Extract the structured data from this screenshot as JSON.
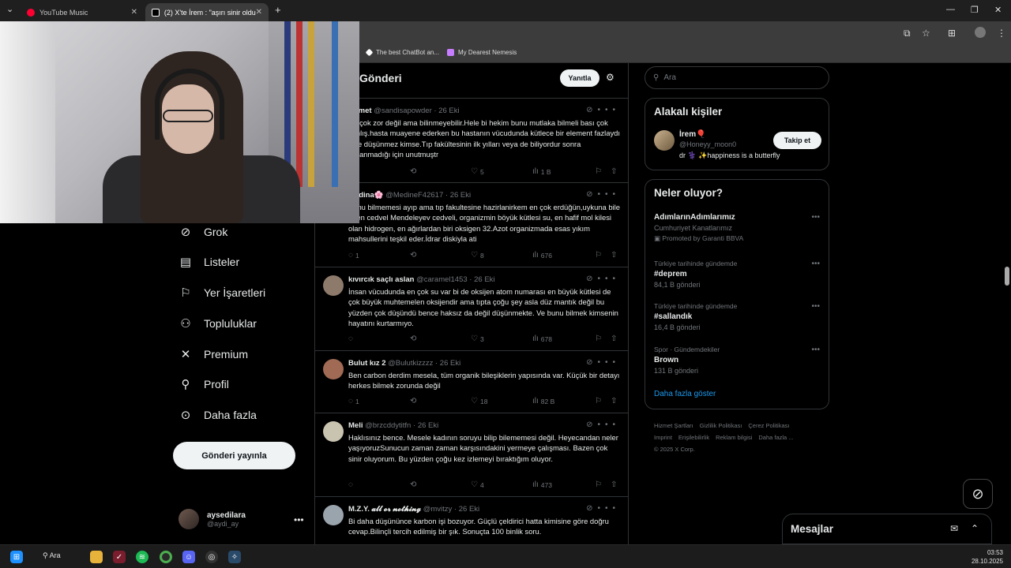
{
  "browser": {
    "tabs": [
      {
        "title": "YouTube Music",
        "active": false
      },
      {
        "title": "(2) X'te İrem  : \"aşırı sinir oldu...",
        "active": true
      }
    ],
    "new_tab": "+",
    "bookmarks": [
      "The best ChatBot an...",
      "My Dearest Nemesis"
    ]
  },
  "nav": {
    "items": [
      "Grok",
      "Listeler",
      "Yer İşaretleri",
      "Topluluklar",
      "Premium",
      "Profil",
      "Daha fazla"
    ],
    "post_button": "Gönderi yayınla",
    "user": {
      "name": "aysedilara",
      "handle": "@aydi_ay"
    }
  },
  "center": {
    "title": "Gönderi",
    "reply_button": "Yanıtla",
    "tweets": [
      {
        "name": "Ahmet",
        "handle": "@sandisapowder",
        "date": "26 Eki",
        "text": "Bu çok zor değil ama bilinmeyebilir.Hele bi hekim bunu mutlaka bilmeli bası çok yanlış.hasta muayene ederken bu hastanın vücudunda kütlece bir element fazlaydı diye düşünmez kimse.Tıp fakültesinin ilk yılları veya de biliyordur sonra kullanmadığı için unutmuştr",
        "replies": "",
        "retweets": "",
        "likes": "5",
        "views": "1 B"
      },
      {
        "name": "Medina🌸",
        "handle": "@MedineF42617",
        "date": "26 Eki",
        "text": "Bunu bilmemesi ayıp ama tıp fakultesine hazirlanirkem en çok erdüğün,uykuna bile giren cedvel Mendeleyev cedveli, organizmin böyük kütlesi su, en hafif mol kilesi olan hidrogen, en ağırlardan biri oksigen 32.Azot organizmada esas yıkım mahsullerini teşkil eder.İdrar diskiyla ati",
        "replies": "1",
        "retweets": "",
        "likes": "8",
        "views": "676"
      },
      {
        "name": "kıvırcık saçlı aslan",
        "handle": "@caramel1453",
        "date": "26 Eki",
        "text": "İnsan vücudunda en çok su var bi de oksijen atom numarası en büyük kütlesi de çok büyük muhtemelen oksijendir ama tıpta çoğu şey asla düz mantık değil bu yüzden çok düşündü bence haksız da değil düşünmekte. Ve bunu bilmek kimsenin hayatını kurtarmıyo.",
        "replies": "",
        "retweets": "",
        "likes": "3",
        "views": "678"
      },
      {
        "name": "Bulut kız 2",
        "handle": "@Bulutkizzzz",
        "date": "26 Eki",
        "text": "Ben carbon derdim mesela, tüm organik bileşiklerin yapısında var. Küçük bir detayı herkes bilmek zorunda değil",
        "replies": "1",
        "retweets": "",
        "likes": "18",
        "views": "82 B"
      },
      {
        "name": "Meli",
        "handle": "@brzcddytitfn",
        "date": "26 Eki",
        "text": "Haklısınız bence. Mesele kadının soruyu bilip bilememesi değil. Heyecandan neler yaşıyoruzSunucun zaman zaman karşısındakini yermeye çalışması. Bazen çok sinir oluyorum. Bu yüzden çoğu kez izlemeyi bıraktığım oluyor.",
        "replies": "",
        "retweets": "",
        "likes": "4",
        "views": "473"
      },
      {
        "name": "M.Z.Y. 𝓪𝓵𝓵 𝓸𝓻 𝓷𝓸𝓽𝓱𝓲𝓷𝓰",
        "handle": "@mvitzy",
        "date": "26 Eki",
        "text": "Bi daha düşününce karbon işi bozuyor. Güçlü çeldirici hatta kimisine göre doğru cevap.Bilinçli tercih edilmiş bir şık. Sonuçta 100 binlik soru.",
        "replies": "",
        "retweets": "",
        "likes": "",
        "views": ""
      }
    ]
  },
  "right": {
    "search_placeholder": "Ara",
    "related": {
      "title": "Alakalı kişiler",
      "person": {
        "name": "İrem🎈",
        "handle": "@Honeyy_moon0",
        "bio": "dr ⚕️ ✨happiness is a butterfly"
      },
      "follow_button": "Takip et"
    },
    "trends": {
      "title": "Neler oluyor?",
      "items": [
        {
          "category": "",
          "name": "AdımlarınAdımlarımız",
          "sub": "Cumhuriyet Kanatlarımız",
          "promoted": "Promoted by Garanti BBVA"
        },
        {
          "category": "Türkiye tarihinde gündemde",
          "name": "#deprem",
          "sub": "84,1 B gönderi"
        },
        {
          "category": "Türkiye tarihinde gündemde",
          "name": "#sallandık",
          "sub": "16,4 B gönderi"
        },
        {
          "category": "Spor · Gündemdekiler",
          "name": "Brown",
          "sub": "131 B gönderi"
        }
      ],
      "show_more": "Daha fazla göster"
    },
    "footer": [
      "Hizmet Şartları",
      "Gizlilik Politikası",
      "Çerez Politikası",
      "Imprint",
      "Erişilebilirlik",
      "Reklam bilgisi",
      "Daha fazla ...",
      "© 2025 X Corp."
    ]
  },
  "messages": {
    "title": "Mesajlar"
  },
  "taskbar": {
    "search": "Ara",
    "time": "03:53",
    "date": "28.10.2025"
  },
  "colors": {
    "accent": "#1d9bf0",
    "bg": "#000000",
    "muted": "#71767b",
    "border": "#2f3336"
  }
}
